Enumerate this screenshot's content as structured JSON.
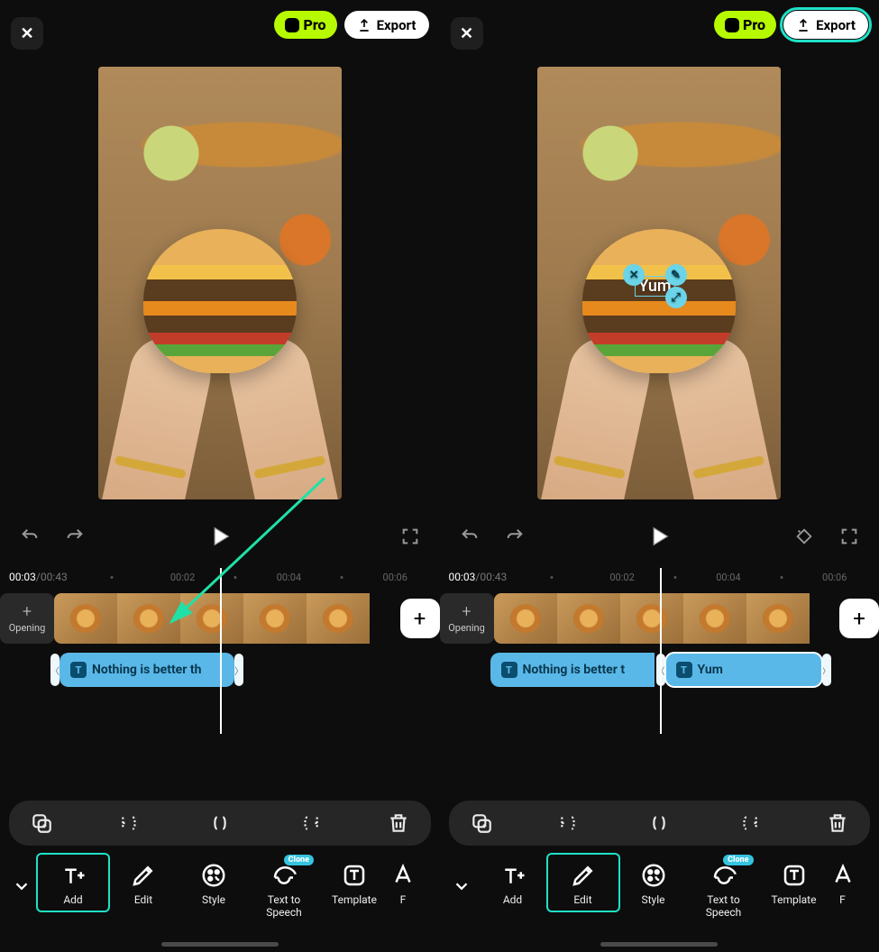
{
  "leftPanel": {
    "proLabel": "Pro",
    "exportLabel": "Export",
    "time": {
      "current": "00:03",
      "total": "/00:43"
    },
    "ruler": [
      "00:02",
      "00:04",
      "00:06"
    ],
    "openingLabel": "Opening",
    "textClip1": "Nothing is better th",
    "editPillLabels": {
      "copy": "copy",
      "splitL": "split-left",
      "split": "split",
      "splitR": "split-right",
      "delete": "delete"
    },
    "tools": {
      "add": "Add",
      "edit": "Edit",
      "style": "Style",
      "tts": "Text to\nSpeech",
      "clone": "Clone",
      "template": "Template",
      "font": "F"
    }
  },
  "rightPanel": {
    "proLabel": "Pro",
    "exportLabel": "Export",
    "overlayText": "Yum",
    "time": {
      "current": "00:03",
      "total": "/00:43"
    },
    "ruler": [
      "00:02",
      "00:04",
      "00:06"
    ],
    "openingLabel": "Opening",
    "textClip1": "Nothing is better t",
    "textClip2": "Yum",
    "tools": {
      "add": "Add",
      "edit": "Edit",
      "style": "Style",
      "tts": "Text to\nSpeech",
      "clone": "Clone",
      "template": "Template",
      "font": "F"
    }
  }
}
